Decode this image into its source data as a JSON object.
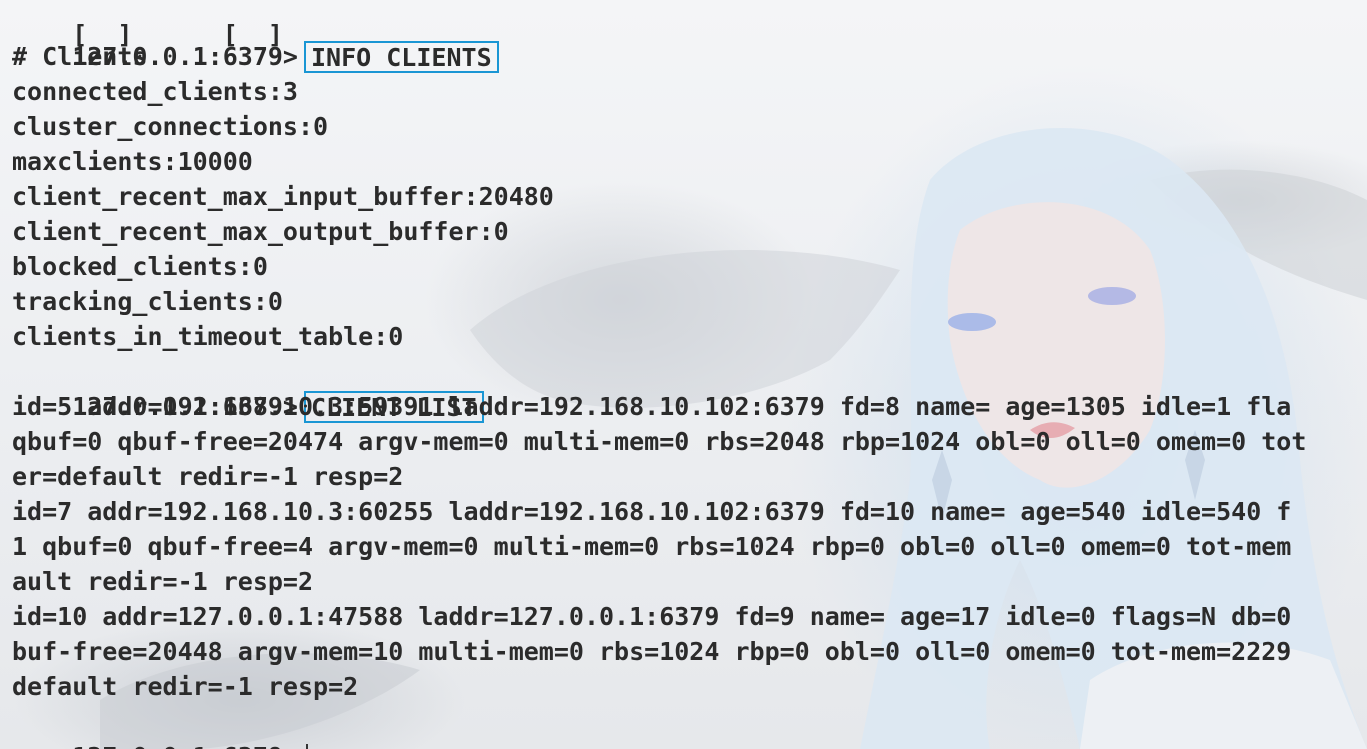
{
  "terminal": {
    "prompt": "127.0.0.1:6379>",
    "commands": {
      "info_clients": "INFO CLIENTS",
      "client_list": "CLIENT LIST"
    },
    "top_partial": "[  ]      [  ]",
    "info_output": [
      "# Clients",
      "connected_clients:3",
      "cluster_connections:0",
      "maxclients:10000",
      "client_recent_max_input_buffer:20480",
      "client_recent_max_output_buffer:0",
      "blocked_clients:0",
      "tracking_clients:0",
      "clients_in_timeout_table:0"
    ],
    "client_list_output": [
      "id=5 addr=192.168.10.3:59391 laddr=192.168.10.102:6379 fd=8 name= age=1305 idle=1 fla",
      "qbuf=0 qbuf-free=20474 argv-mem=0 multi-mem=0 rbs=2048 rbp=1024 obl=0 oll=0 omem=0 tot",
      "er=default redir=-1 resp=2",
      "id=7 addr=192.168.10.3:60255 laddr=192.168.10.102:6379 fd=10 name= age=540 idle=540 f",
      "1 qbuf=0 qbuf-free=4 argv-mem=0 multi-mem=0 rbs=1024 rbp=0 obl=0 oll=0 omem=0 tot-mem",
      "ault redir=-1 resp=2",
      "id=10 addr=127.0.0.1:47588 laddr=127.0.0.1:6379 fd=9 name= age=17 idle=0 flags=N db=0",
      "buf-free=20448 argv-mem=10 multi-mem=0 rbs=1024 rbp=0 obl=0 oll=0 omem=0 tot-mem=2229",
      "default redir=-1 resp=2"
    ]
  },
  "colors": {
    "text": "#2b2b2b",
    "highlight_border": "#1a96d4"
  }
}
